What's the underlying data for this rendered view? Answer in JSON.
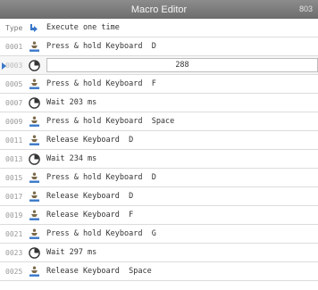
{
  "window": {
    "title": "Macro Editor",
    "badge": "803"
  },
  "type_row": {
    "label": "Type",
    "value": "Execute one time"
  },
  "editing_row": {
    "index": "0003",
    "value": "288"
  },
  "rows": [
    {
      "index": "0001",
      "icon": "keyboard-person-icon",
      "text": "Press & hold Keyboard  D"
    },
    {
      "index": "0005",
      "icon": "keyboard-person-icon",
      "text": "Press & hold Keyboard  F"
    },
    {
      "index": "0007",
      "icon": "clock-icon",
      "text": "Wait 203 ms"
    },
    {
      "index": "0009",
      "icon": "keyboard-person-icon",
      "text": "Press & hold Keyboard  Space"
    },
    {
      "index": "0011",
      "icon": "keyboard-person-icon",
      "text": "Release Keyboard  D"
    },
    {
      "index": "0013",
      "icon": "clock-icon",
      "text": "Wait 234 ms"
    },
    {
      "index": "0015",
      "icon": "keyboard-person-icon",
      "text": "Press & hold Keyboard  D"
    },
    {
      "index": "0017",
      "icon": "keyboard-person-icon",
      "text": "Release Keyboard  D"
    },
    {
      "index": "0019",
      "icon": "keyboard-person-icon",
      "text": "Release Keyboard  F"
    },
    {
      "index": "0021",
      "icon": "keyboard-person-icon",
      "text": "Press & hold Keyboard  G"
    },
    {
      "index": "0023",
      "icon": "clock-icon",
      "text": "Wait 297 ms"
    },
    {
      "index": "0025",
      "icon": "keyboard-person-icon",
      "text": "Release Keyboard  Space"
    }
  ]
}
